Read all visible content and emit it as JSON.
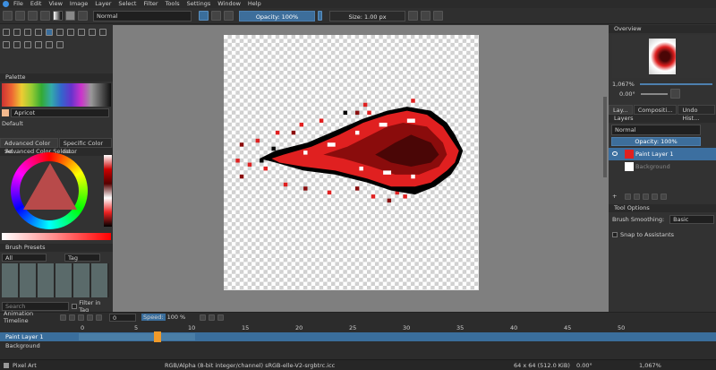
{
  "menubar": {
    "items": [
      "File",
      "Edit",
      "View",
      "Image",
      "Layer",
      "Select",
      "Filter",
      "Tools",
      "Settings",
      "Window",
      "Help"
    ]
  },
  "toolbar": {
    "blend_mode": "Normal",
    "opacity_label": "Opacity: 100%",
    "size_label": "Size: 1.00 px"
  },
  "left": {
    "palette_title": "Palette",
    "palette_name": "Apricot",
    "palette_default": "Default",
    "adv_color_tabs": [
      "Advanced Color Se...",
      "Specific Color Se..."
    ],
    "adv_color_title": "Advanced Color Selector",
    "brush_presets_title": "Brush Presets",
    "brush_filter": "All",
    "brush_tag": "Tag",
    "search_placeholder": "Search",
    "filter_in_tag": "Filter in Tag"
  },
  "right": {
    "overview_title": "Overview",
    "zoom": "1,067%",
    "rotation": "0.00°",
    "tabs": [
      "Lay...",
      "Compositi...",
      "Undo Hist..."
    ],
    "layers_title": "Layers",
    "layers_mode": "Normal",
    "layers_opacity": "Opacity: 100%",
    "layers": [
      {
        "name": "Paint Layer 1",
        "selected": true
      },
      {
        "name": "Background",
        "selected": false
      }
    ],
    "tool_options_title": "Tool Options",
    "brush_smoothing_label": "Brush Smoothing:",
    "brush_smoothing_value": "Basic",
    "snap_to_assistants": "Snap to Assistants"
  },
  "timeline": {
    "title": "Animation Timeline",
    "frame_field": "0",
    "speed_label": "Speed:",
    "speed_value": "100 %",
    "ruler": [
      "0",
      "5",
      "10",
      "15",
      "20",
      "25",
      "30",
      "35",
      "40",
      "45",
      "50",
      "55"
    ],
    "layers": [
      "Paint Layer 1",
      "Background"
    ]
  },
  "status": {
    "brush": "Pixel Art",
    "color_profile": "RGB/Alpha (8-bit integer/channel)  sRGB-elle-V2-srgbtrc.icc",
    "dimensions": "64 x 64 (512.0 KiB)",
    "rotation": "0.00°",
    "zoom": "1,067%"
  },
  "colors": {
    "accent": "#3c6fa0",
    "fireball_red": "#e02020",
    "fireball_dark": "#8a0c0c"
  }
}
